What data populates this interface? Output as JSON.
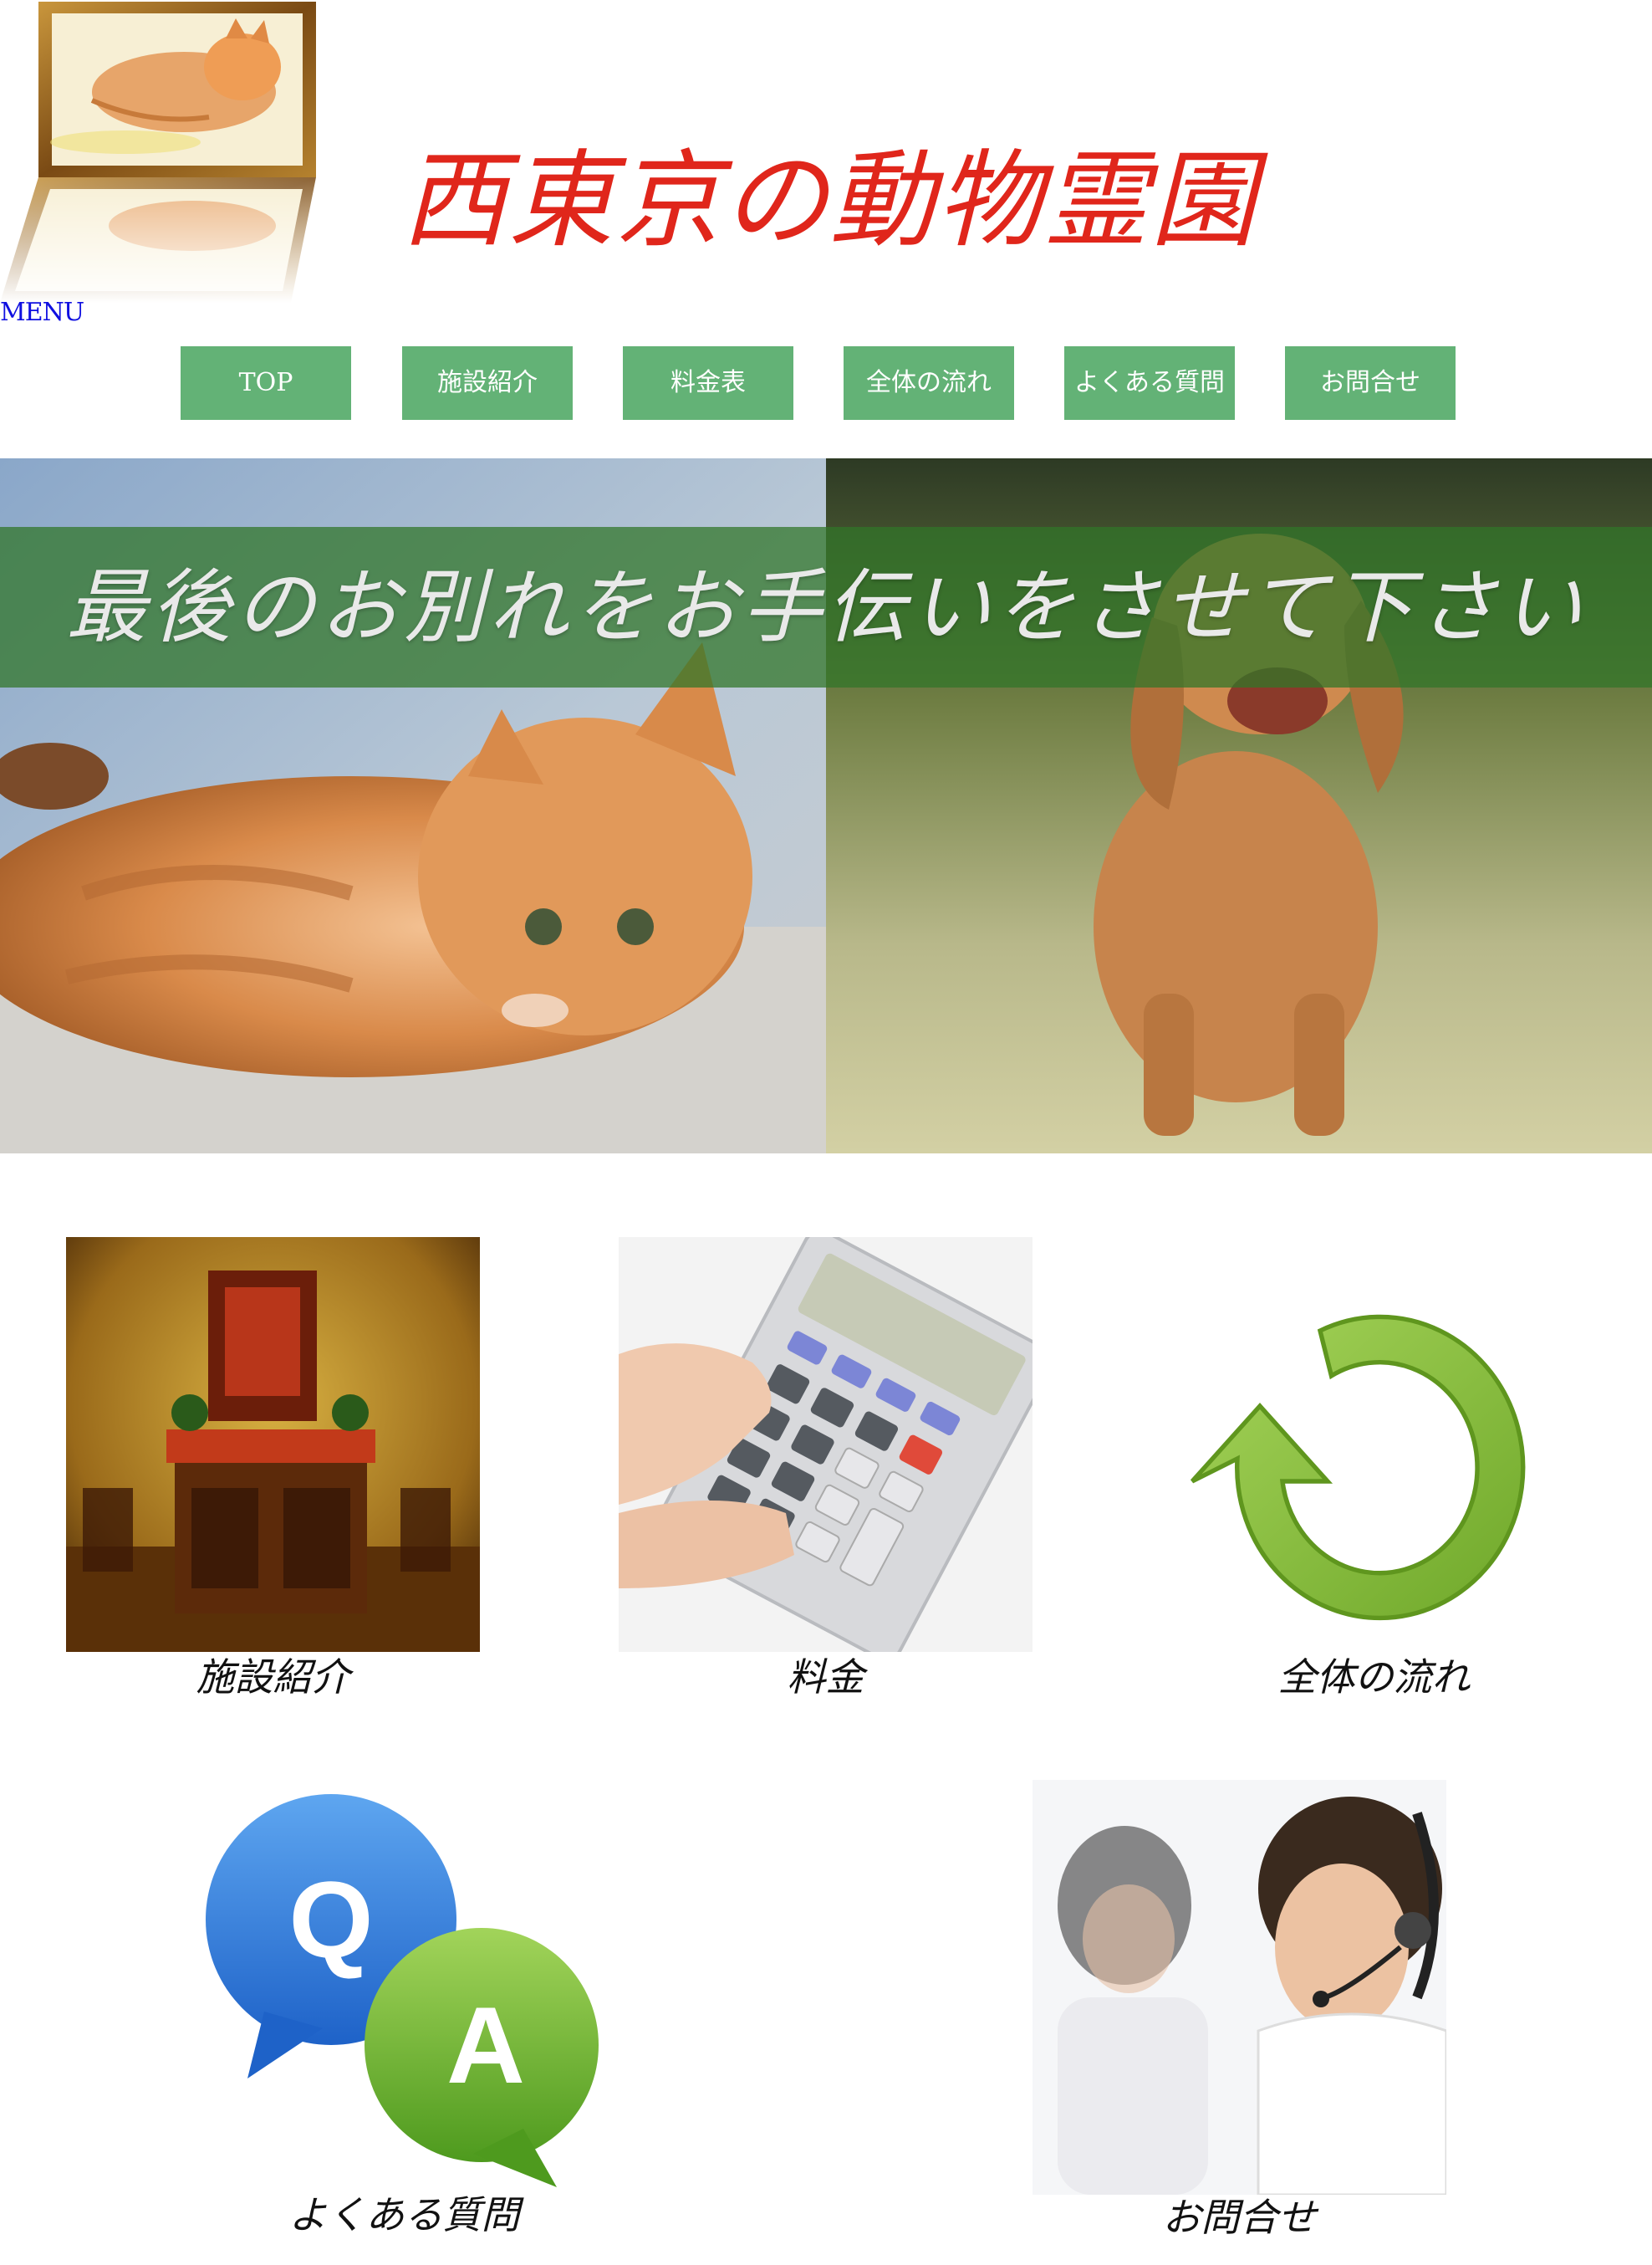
{
  "header": {
    "site_title": "西東京の動物霊園",
    "menu_label": "MENU"
  },
  "nav": {
    "items": [
      {
        "label": "TOP"
      },
      {
        "label": "施設紹介"
      },
      {
        "label": "料金表"
      },
      {
        "label": "全体の流れ"
      },
      {
        "label": "よくある質問"
      },
      {
        "label": "お問合せ"
      }
    ]
  },
  "hero": {
    "tagline": "最後のお別れをお手伝いをさせて下さい"
  },
  "features": {
    "facility": {
      "caption": "施設紹介",
      "icon": "altar-photo"
    },
    "price": {
      "caption": "料金",
      "icon": "calculator-photo"
    },
    "flow": {
      "caption": "全体の流れ",
      "icon": "cycle-arrow-icon"
    },
    "faq": {
      "caption": "よくある質問",
      "icon": "qa-bubbles-icon"
    },
    "contact": {
      "caption": "お問合せ",
      "icon": "headset-operators-photo"
    }
  },
  "colors": {
    "title_red": "#e0261b",
    "nav_green": "#63b276",
    "hero_band_green": "#307628",
    "menu_blue": "#1010e0"
  }
}
